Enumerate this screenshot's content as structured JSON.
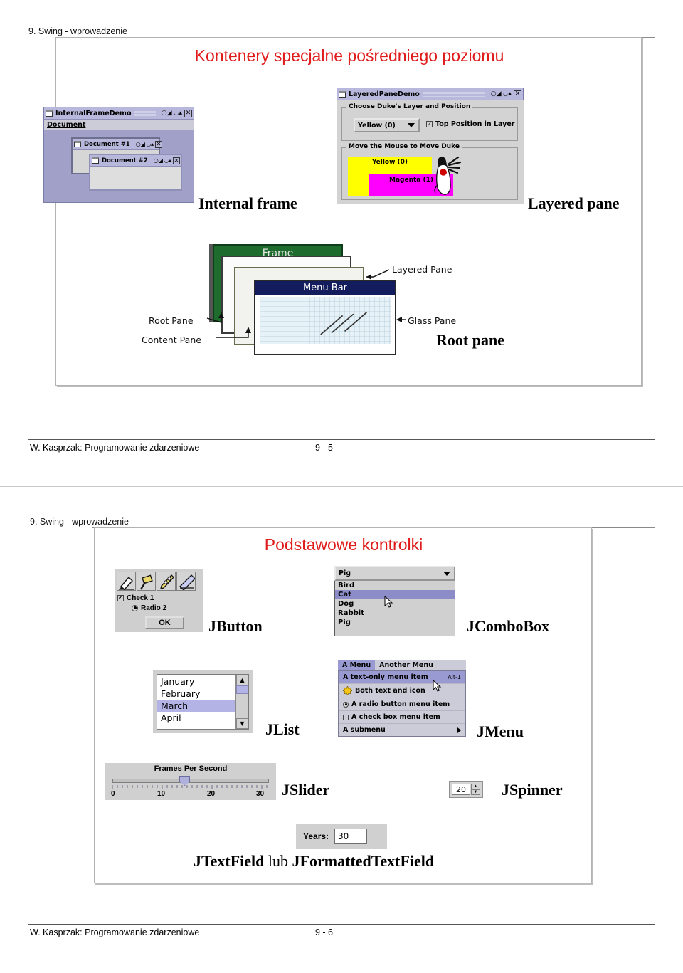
{
  "document": {
    "slides": [
      {
        "header": "9. Swing - wprowadzenie",
        "title": "Kontenery specjalne pośredniego poziomu",
        "footer_author": "W. Kasprzak: Programowanie zdarzeniowe",
        "footer_page": "9 - 5",
        "captions": {
          "internal_frame": "Internal frame",
          "layered_pane": "Layered pane",
          "root_pane": "Root pane"
        },
        "internal_frame_demo": {
          "window_title": "InternalFrameDemo",
          "menu": "Document",
          "children": [
            {
              "title": "Document #1"
            },
            {
              "title": "Document #2"
            }
          ],
          "window_buttons": [
            "minimize",
            "maximize",
            "close"
          ]
        },
        "layered_pane_demo": {
          "window_title": "LayeredPaneDemo",
          "group1_label": "Choose Duke's Layer and Position",
          "combo_value": "Yellow (0)",
          "checkbox_label": "Top Position in Layer",
          "checkbox_checked": true,
          "group2_label": "Move the Mouse to Move Duke",
          "layers": [
            {
              "label": "Yellow (0)",
              "color": "#ffff00"
            },
            {
              "label": "Magenta (1)",
              "color": "#ff00ff"
            }
          ]
        },
        "root_pane_diagram": {
          "frame_label": "Frame",
          "menubar_label": "Menu Bar",
          "layered_pane_label": "Layered Pane",
          "glass_pane_label": "Glass Pane",
          "root_pane_label": "Root Pane",
          "content_pane_label": "Content Pane"
        }
      },
      {
        "header": "9. Swing - wprowadzenie",
        "title": "Podstawowe kontrolki",
        "footer_author": "W. Kasprzak: Programowanie zdarzeniowe",
        "footer_page": "9 - 6",
        "captions": {
          "jbutton": "JButton",
          "jcombobox": "JComboBox",
          "jlist": "JList",
          "jmenu": "JMenu",
          "jslider": "JSlider",
          "jspinner": "JSpinner",
          "jtextfield": "JTextField",
          "jtextfield_conj": " lub ",
          "jformattedtextfield": "JFormattedTextField"
        },
        "jbutton_panel": {
          "toolbar_icons": [
            "pencil-icon",
            "hammer-icon",
            "wrench-icon",
            "ruler-icon"
          ],
          "checkbox_label": "Check 1",
          "checkbox_checked": true,
          "radio_label": "Radio 2",
          "radio_selected": true,
          "ok_label": "OK"
        },
        "jcombobox": {
          "selected": "Pig",
          "items": [
            "Bird",
            "Cat",
            "Dog",
            "Rabbit",
            "Pig"
          ],
          "highlighted": "Cat"
        },
        "jlist": {
          "items": [
            "January",
            "February",
            "March",
            "April"
          ],
          "selected": "March"
        },
        "jmenu": {
          "menubar": [
            {
              "label": "A Menu",
              "active": true
            },
            {
              "label": "Another Menu",
              "active": false
            }
          ],
          "items": [
            {
              "label": "A text-only menu item",
              "accelerator": "Alt-1",
              "type": "plain",
              "selected": true
            },
            {
              "label": "Both text and icon",
              "type": "icon",
              "selected": false
            },
            {
              "label": "A radio button menu item",
              "type": "radio",
              "checked": true,
              "selected": false
            },
            {
              "label": "A check box menu item",
              "type": "checkbox",
              "checked": false,
              "selected": false
            },
            {
              "label": "A submenu",
              "type": "submenu",
              "selected": false
            }
          ]
        },
        "jslider": {
          "title": "Frames Per Second",
          "min": 0,
          "max": 30,
          "value": 15,
          "ticks": [
            "0",
            "10",
            "20",
            "30"
          ]
        },
        "jspinner": {
          "value": "20"
        },
        "jtextfield": {
          "label": "Years:",
          "value": "30"
        }
      }
    ]
  },
  "colors": {
    "title_red": "#e01b1b",
    "metal_blue": "#b8b8dc",
    "selection": "#b3b3e6",
    "menu_selection": "#9a9ad2",
    "yellow_layer": "#ffff00",
    "magenta_layer": "#ff00ff",
    "frame_green": "#1d6b2d",
    "menubar_navy": "#131c5c",
    "glass_tint": "#e6f2f7"
  }
}
